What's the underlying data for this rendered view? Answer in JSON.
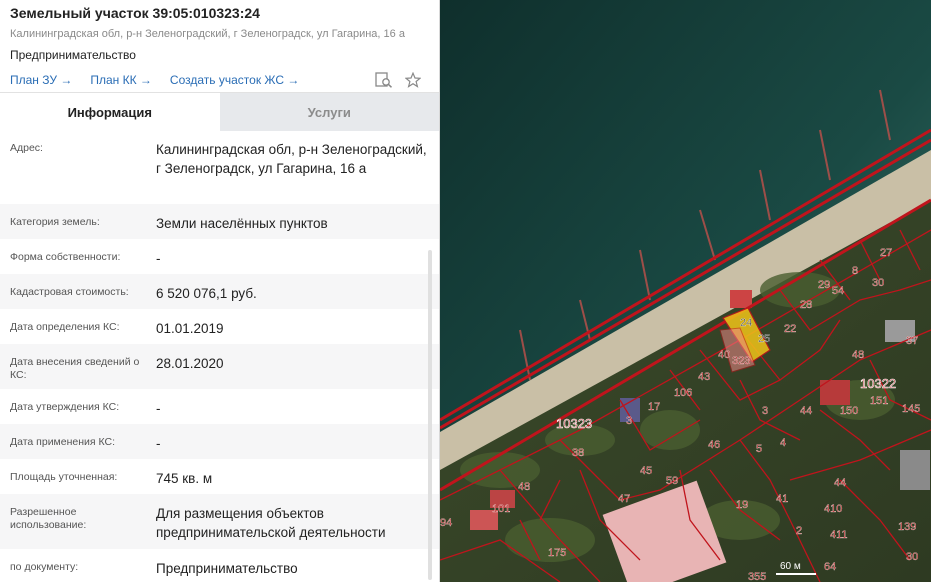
{
  "header": {
    "title": "Земельный участок 39:05:010323:24",
    "address": "Калининградская обл, р-н Зеленоградский, г Зеленоградск, ул Гагарина, 16 а",
    "purpose": "Предпринимательство",
    "links": [
      "План ЗУ →",
      "План КК →",
      "Создать участок ЖС →"
    ]
  },
  "tabs": [
    {
      "label": "Информация",
      "active": true
    },
    {
      "label": "Услуги",
      "active": false
    }
  ],
  "rows": [
    {
      "label": "Адрес:",
      "value": "Калининградская обл, р-н Зеленоградский, г Зеленоградск, ул Гагарина, 16 а",
      "h": 74
    },
    {
      "label": "Категория земель:",
      "value": "Земли населённых пунктов",
      "h": 35
    },
    {
      "label": "Форма собственности:",
      "value": "-",
      "h": 35
    },
    {
      "label": "Кадастровая стоимость:",
      "value": "6 520 076,1 руб.",
      "h": 35
    },
    {
      "label": "Дата определения КС:",
      "value": "01.01.2019",
      "h": 35
    },
    {
      "label": "Дата внесения сведений о КС:",
      "value": "28.01.2020",
      "h": 45
    },
    {
      "label": "Дата утверждения КС:",
      "value": "-",
      "h": 35
    },
    {
      "label": "Дата применения КС:",
      "value": "-",
      "h": 35
    },
    {
      "label": "Площадь уточненная:",
      "value": "745 кв. м",
      "h": 35
    },
    {
      "label": "Разрешенное использование:",
      "value": "Для размещения объектов предпринимательской деятельности",
      "h": 55
    },
    {
      "label": "по документу:",
      "value": "Предпринимательство",
      "h": 35
    }
  ],
  "map": {
    "quarter_labels": [
      "10323",
      "10322"
    ],
    "parcel_labels": [
      "24",
      "25",
      "22",
      "29",
      "8",
      "27",
      "28",
      "54",
      "30",
      "40",
      "323",
      "43",
      "106",
      "17",
      "48",
      "3",
      "44",
      "150",
      "151",
      "145",
      "46",
      "38",
      "5",
      "4",
      "45",
      "59",
      "47",
      "48",
      "101",
      "94",
      "19",
      "41",
      "44",
      "410",
      "411",
      "175",
      "139",
      "30",
      "2",
      "355",
      "64",
      "37",
      "3"
    ],
    "scale_label": "60 м"
  },
  "colors": {
    "accent": "#2a6db5",
    "parcel_line": "#c0141c",
    "selected_fill": "#f0c419"
  }
}
